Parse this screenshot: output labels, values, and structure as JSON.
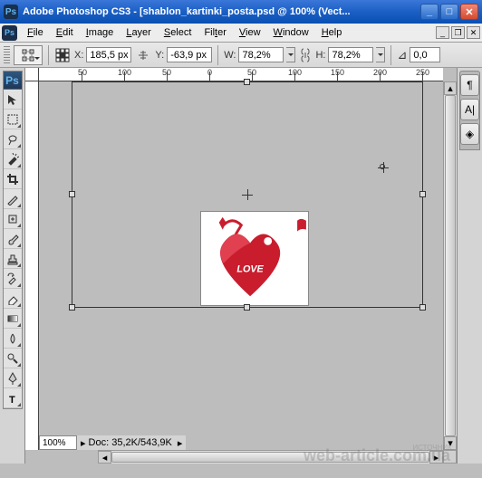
{
  "titlebar": {
    "app_logo": "Ps",
    "title": "Adobe Photoshop CS3 - [shablon_kartinki_posta.psd @ 100% (Vect..."
  },
  "menu": {
    "items": [
      "File",
      "Edit",
      "Image",
      "Layer",
      "Select",
      "Filter",
      "View",
      "Window",
      "Help"
    ]
  },
  "options": {
    "x_label": "X:",
    "x_value": "185,5 px",
    "y_label": "Y:",
    "y_value": "-63,9 px",
    "w_label": "W:",
    "w_value": "78,2%",
    "h_label": "H:",
    "h_value": "78,2%",
    "rot_label": "∠",
    "rot_value": "0,0"
  },
  "ruler": {
    "ticks": [
      {
        "pos": 15,
        "label": ""
      },
      {
        "pos": 62,
        "label": "50"
      },
      {
        "pos": 109,
        "label": "100"
      },
      {
        "pos": 156,
        "label": "50"
      },
      {
        "pos": 203,
        "label": "0"
      },
      {
        "pos": 250,
        "label": "50"
      },
      {
        "pos": 297,
        "label": "100"
      },
      {
        "pos": 344,
        "label": "150"
      },
      {
        "pos": 391,
        "label": "200"
      },
      {
        "pos": 438,
        "label": "250"
      }
    ]
  },
  "canvas": {
    "heart_text": "LOVE"
  },
  "status": {
    "zoom": "100%",
    "doc_info": "Doc: 35,2K/543,9K"
  },
  "tools": [
    "move-tool",
    "marquee-tool",
    "lasso-tool",
    "wand-tool",
    "crop-tool",
    "slice-tool",
    "spot-heal-tool",
    "brush-tool",
    "stamp-tool",
    "history-brush-tool",
    "eraser-tool",
    "gradient-tool",
    "blur-tool",
    "dodge-tool",
    "pen-tool",
    "type-tool"
  ],
  "dock": {
    "items": [
      "¶",
      "A|",
      "◈"
    ]
  },
  "watermark": "web-article.com.ua",
  "watermark2": "ИСТОЧНИК:"
}
